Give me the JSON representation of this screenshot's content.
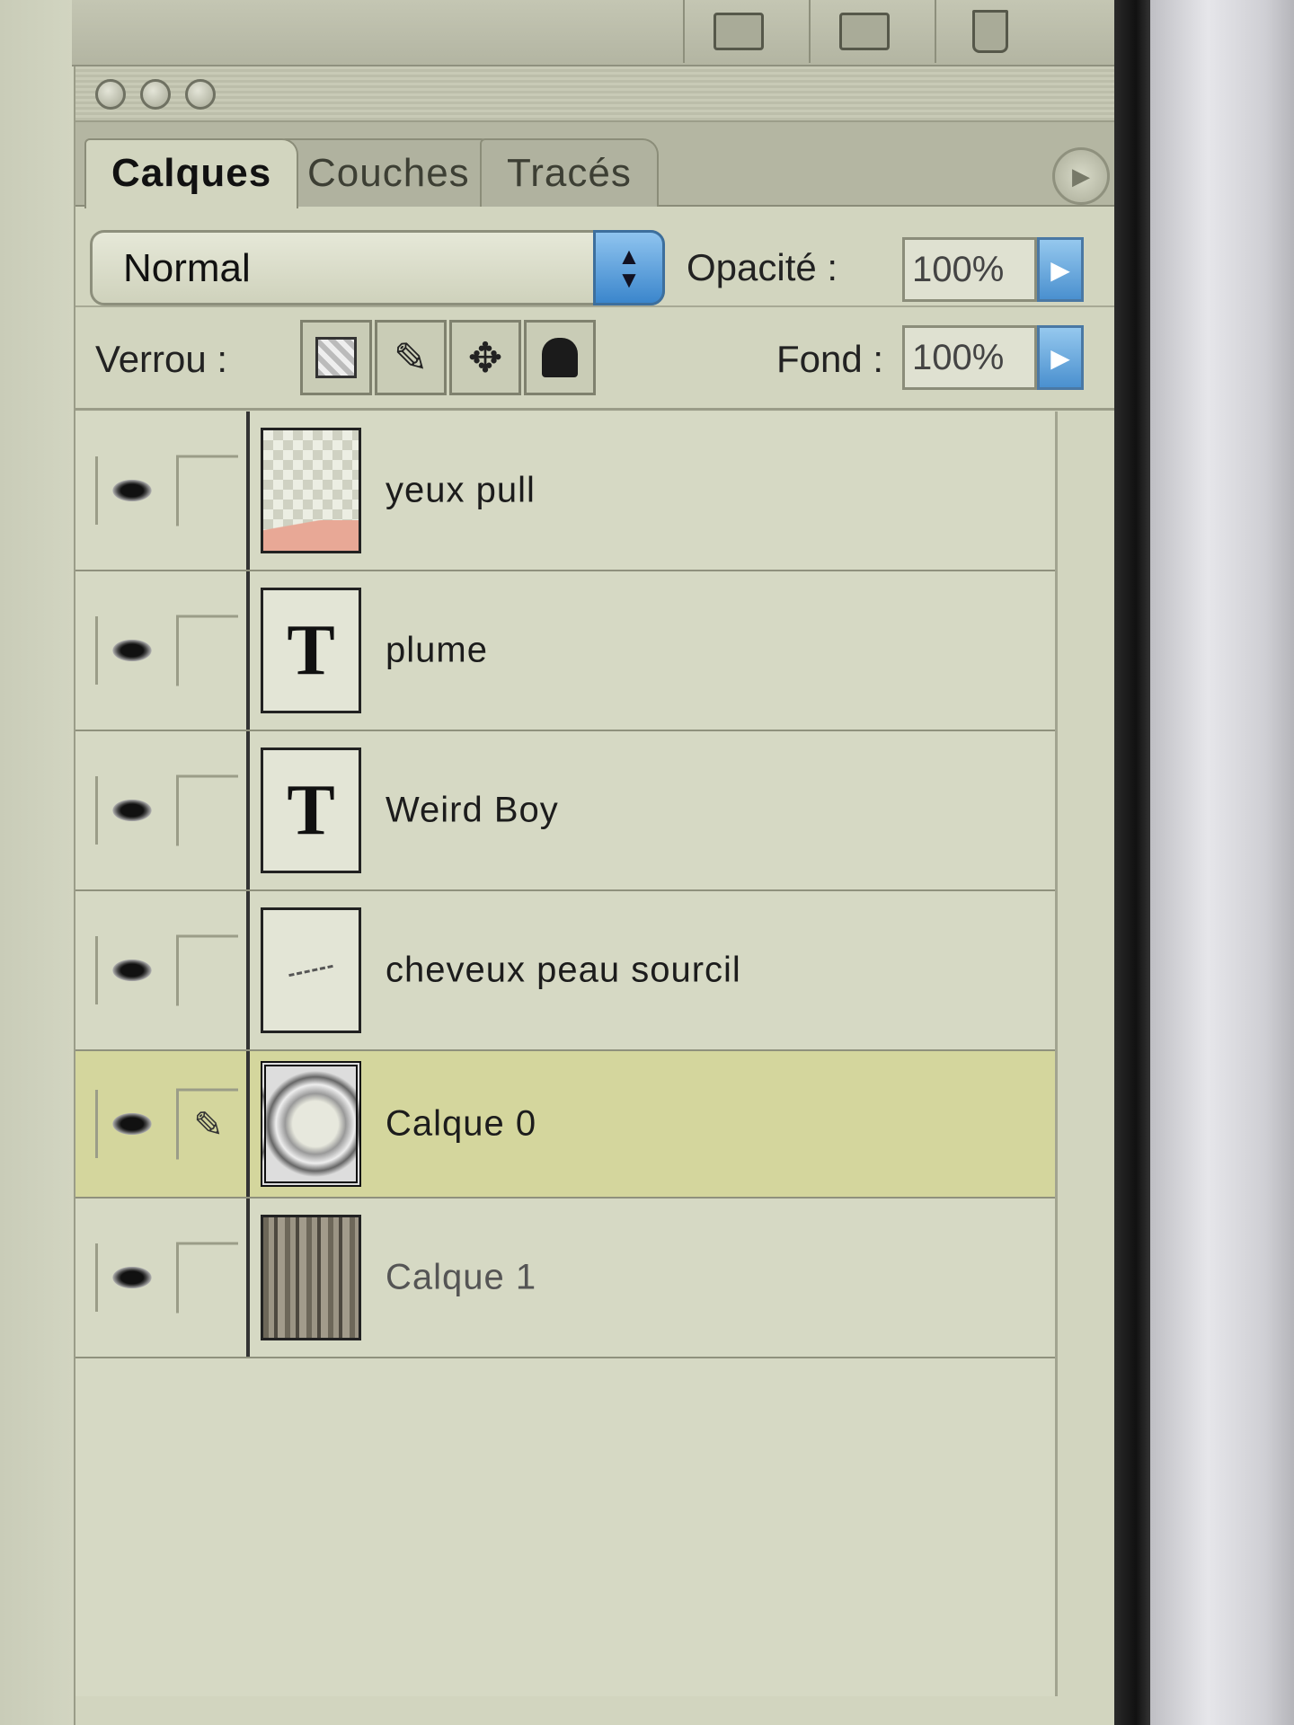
{
  "toolbar_icons": [
    "new-window-icon",
    "camera-icon",
    "trash-icon"
  ],
  "tabs": [
    {
      "label": "Calques",
      "active": true
    },
    {
      "label": "Couches",
      "active": false
    },
    {
      "label": "Tracés",
      "active": false
    }
  ],
  "blend_mode": {
    "value": "Normal"
  },
  "opacity": {
    "label": "Opacité :",
    "value": "100%"
  },
  "lock": {
    "label": "Verrou :"
  },
  "fill": {
    "label": "Fond :",
    "value": "100%"
  },
  "layers": [
    {
      "name": "yeux pull",
      "visible": true,
      "thumb": "checker",
      "selected": false
    },
    {
      "name": "plume",
      "visible": true,
      "thumb": "text",
      "selected": false
    },
    {
      "name": "Weird Boy",
      "visible": true,
      "thumb": "text",
      "selected": false
    },
    {
      "name": "cheveux peau sourcil",
      "visible": true,
      "thumb": "sketch",
      "selected": false
    },
    {
      "name": "Calque 0",
      "visible": true,
      "thumb": "face",
      "selected": true,
      "brush": true
    },
    {
      "name": "Calque 1",
      "visible": true,
      "thumb": "wood",
      "selected": false
    }
  ],
  "colors": {
    "selected_row": "#d4d69d",
    "accent_blue": "#4a90cf"
  }
}
